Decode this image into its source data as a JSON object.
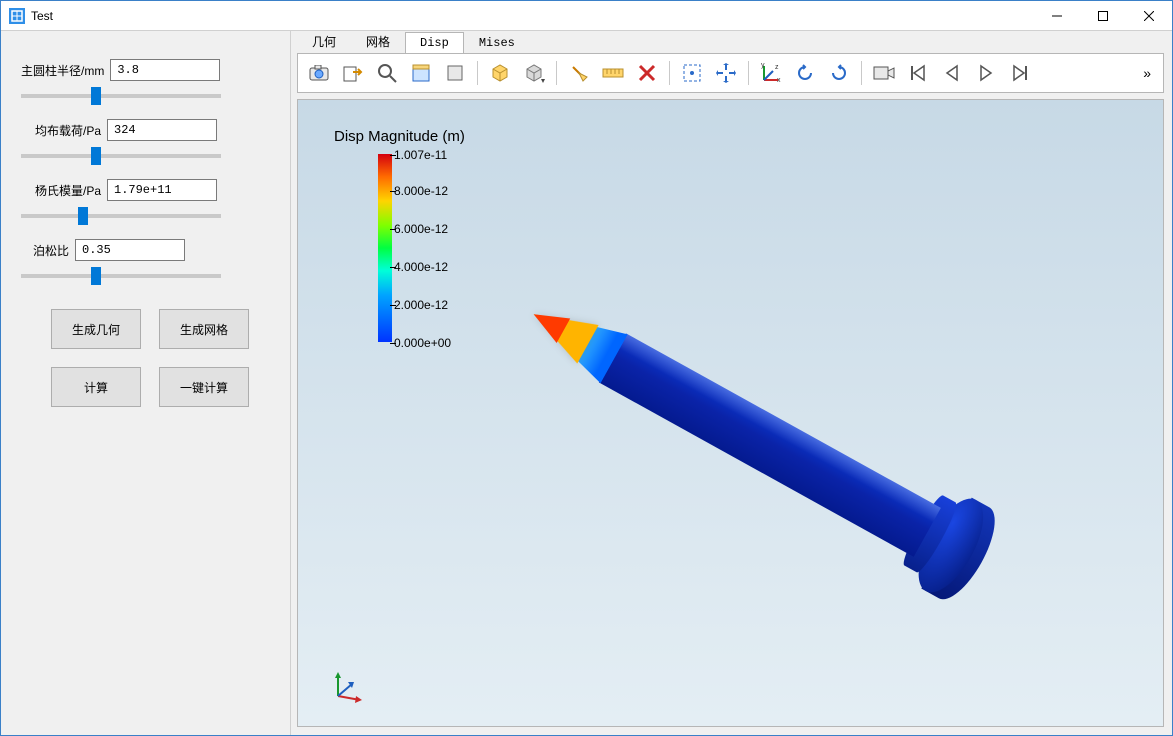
{
  "window": {
    "title": "Test"
  },
  "params": {
    "radius": {
      "label": "主圆柱半径/mm",
      "value": "3.8",
      "slider": 37
    },
    "load": {
      "label": "均布载荷/Pa",
      "value": "324",
      "slider": 37
    },
    "young": {
      "label": "杨氏模量/Pa",
      "value": "1.79e+11",
      "slider": 30
    },
    "poisson": {
      "label": "泊松比",
      "value": "0.35",
      "slider": 37
    }
  },
  "buttons": {
    "gen_geom": "生成几何",
    "gen_mesh": "生成网格",
    "compute": "计算",
    "one_click": "一键计算"
  },
  "tabs": {
    "items": [
      "几何",
      "网格",
      "Disp",
      "Mises"
    ],
    "active": 2
  },
  "toolbar_icons": [
    "camera-icon",
    "export-icon",
    "zoom-icon",
    "bbox-icon",
    "surface-icon",
    "cube-pick-icon",
    "cube-dropdown-icon",
    "broom-icon",
    "ruler-icon",
    "delete-icon",
    "select-rect-icon",
    "crosshair-icon",
    "axes-icon",
    "rotate-left-icon",
    "rotate-right-icon",
    "video-icon",
    "prev-end-icon",
    "prev-icon",
    "play-icon",
    "next-end-icon"
  ],
  "legend": {
    "title": "Disp Magnitude (m)",
    "ticks": [
      "1.007e-11",
      "8.000e-12",
      "6.000e-12",
      "4.000e-12",
      "2.000e-12",
      "0.000e+00"
    ]
  },
  "chart_data": {
    "type": "heatmap",
    "title": "Disp Magnitude (m)",
    "colorbar": {
      "min_label": "0.000e+00",
      "max_label": "1.007e-11",
      "ticks": [
        "1.007e-11",
        "8.000e-12",
        "6.000e-12",
        "4.000e-12",
        "2.000e-12",
        "0.000e+00"
      ],
      "range": [
        0.0,
        1.007e-11
      ]
    },
    "field": "displacement_magnitude",
    "units": "m",
    "note": "3D FEA contour on a nail-shaped solid; max displacement at tip, ~0 at head"
  }
}
